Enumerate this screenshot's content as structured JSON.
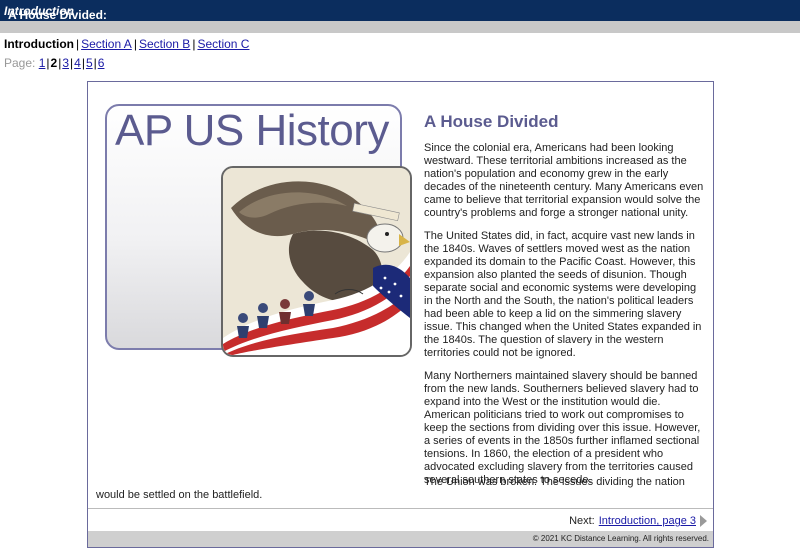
{
  "header": {
    "title": "A House Divided:",
    "subtitle": "Introduction"
  },
  "sections_nav": {
    "current": "Introduction",
    "links": [
      "Section A",
      "Section B",
      "Section C"
    ]
  },
  "pages_nav": {
    "label": "Page:",
    "pages": [
      "1",
      "2",
      "3",
      "4",
      "5",
      "6"
    ],
    "current": "2"
  },
  "cover": {
    "title": "AP US History"
  },
  "article": {
    "heading": "A House Divided",
    "paragraphs": [
      "Since the colonial era, Americans had been looking westward. These territorial ambitions increased as the nation's population and economy grew in the early decades of the nineteenth century. Many Americans even came to believe that territorial expansion would solve the country's problems and forge a stronger national unity.",
      "The United States did, in fact, acquire vast new lands in the 1840s. Waves of settlers moved west as the nation expanded its domain to the Pacific Coast. However, this expansion also planted the seeds of disunion. Though separate social and economic systems were developing in the North and the South, the nation's political leaders had been able to keep a lid on the simmering slavery issue. This changed when the United States expanded in the 1840s. The question of slavery in the western territories could not be ignored.",
      "Many Northerners maintained slavery should be banned from the new lands. Southerners believed slavery had to expand into the West or the institution would die. American politicians tried to work out compromises to keep the sections from dividing over this issue. However, a series of events in the 1850s further inflamed sectional tensions. In 1860, the election of a president who advocated excluding slavery from the territories caused several southern states to secede."
    ],
    "last_paragraph": "The Union was broken. The issues dividing the nation would be settled on the battlefield."
  },
  "next_nav": {
    "label": "Next:",
    "link": "Introduction, page 3"
  },
  "footer": {
    "copyright": "© 2021 KC Distance Learning. All rights reserved."
  },
  "colors": {
    "header_bg": "#0b2d5e",
    "link": "#1a1aa6",
    "heading": "#5b5b8f"
  }
}
